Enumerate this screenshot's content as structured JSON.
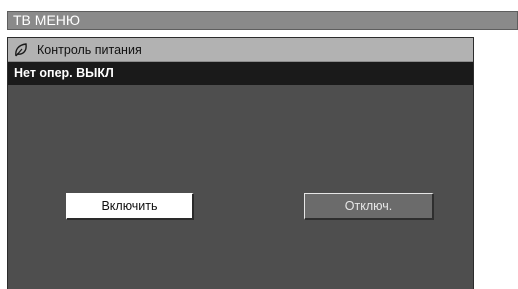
{
  "menu": {
    "title": "ТВ МЕНЮ"
  },
  "panel": {
    "icon": "leaf-icon",
    "title": "Контроль питания",
    "status": "Нет опер. ВЫКЛ"
  },
  "buttons": {
    "on_label": "Включить",
    "off_label": "Отключ."
  },
  "colors": {
    "top_bar": "#8a8a8a",
    "panel_bg": "#4e4e4e",
    "header_bg": "#b2b2b2",
    "status_bg": "#1a1a1a",
    "selected_button": "#ffffff",
    "unselected_button": "#6b6b6b"
  }
}
